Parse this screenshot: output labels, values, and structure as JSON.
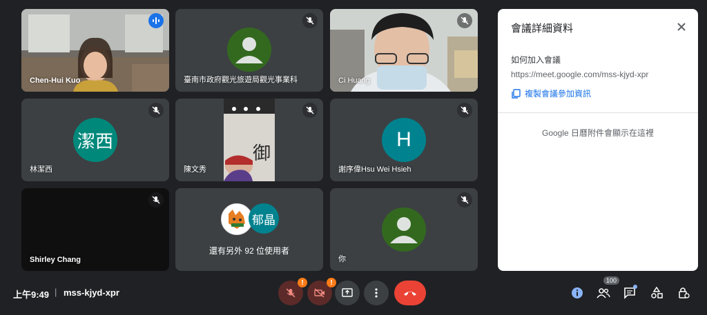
{
  "tiles": [
    {
      "name": "Chen-Hui Kuo"
    },
    {
      "name": "臺南市政府觀光旅遊局觀光事業科"
    },
    {
      "name": "Ci Huang"
    },
    {
      "name": "林潔西",
      "avatar_text": "潔西"
    },
    {
      "name": "陳文秀"
    },
    {
      "name": "謝序偉Hsu Wei Hsieh",
      "avatar_text": "H"
    },
    {
      "name": "Shirley Chang"
    },
    {
      "others_avatar_text": "郁晶",
      "others_label": "還有另外 92 位使用者"
    },
    {
      "name": "你"
    }
  ],
  "colors": {
    "accent": "#8ab4f8",
    "end_call": "#ea4335",
    "warning": "#fa7b17",
    "avatar_green": "#33691e",
    "avatar_teal": "#00897b"
  },
  "details_panel": {
    "title": "會議詳細資料",
    "join_heading": "如何加入會議",
    "meeting_url": "https://meet.google.com/mss-kjyd-xpr",
    "copy_label": "複製會議參加資訊",
    "calendar_note": "Google 日曆附件會顯示在這裡"
  },
  "bottom_bar": {
    "time": "上午9:49",
    "separator": "|",
    "meeting_code": "mss-kjyd-xpr",
    "warning_mark": "!",
    "participants_count": "100"
  }
}
